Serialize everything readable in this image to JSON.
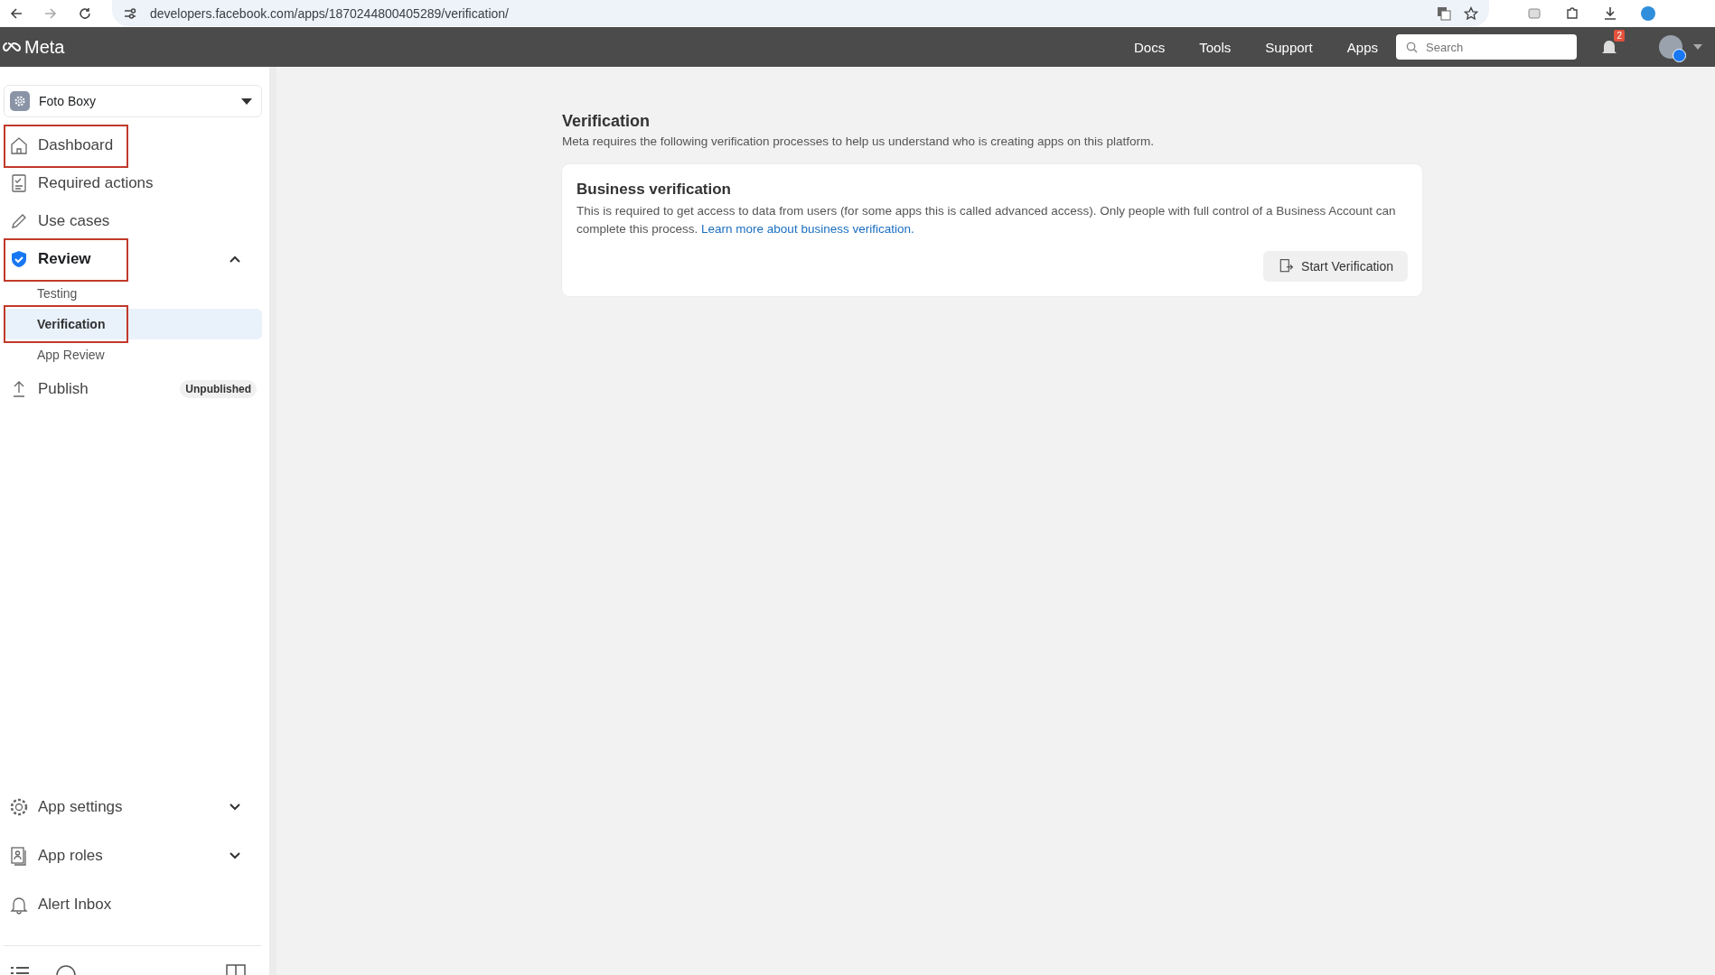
{
  "browser": {
    "url": "developers.facebook.com/apps/1870244800405289/verification/"
  },
  "header": {
    "logo": "Meta",
    "nav": [
      "Docs",
      "Tools",
      "Support",
      "Apps"
    ],
    "search": {
      "placeholder": "Search"
    },
    "notification_count": "2"
  },
  "sidebar": {
    "app_selector": "Foto Boxy",
    "items": [
      {
        "label": "Dashboard",
        "annotated": true
      },
      {
        "label": "Required actions",
        "annotated": false
      },
      {
        "label": "Use cases",
        "annotated": false
      },
      {
        "label": "Review",
        "annotated": true,
        "active": true,
        "expanded": true,
        "children": [
          {
            "label": "Testing",
            "selected": false,
            "annotated": false
          },
          {
            "label": "Verification",
            "selected": true,
            "annotated": true
          },
          {
            "label": "App Review",
            "selected": false,
            "annotated": false
          }
        ]
      },
      {
        "label": "Publish",
        "annotated": false,
        "badge": "Unpublished"
      }
    ],
    "bottom_items": [
      {
        "label": "App settings",
        "expanded": false
      },
      {
        "label": "App roles",
        "expanded": false
      },
      {
        "label": "Alert Inbox"
      }
    ]
  },
  "page": {
    "title": "Verification",
    "description": "Meta requires the following verification processes to help us understand who is creating apps on this platform.",
    "card": {
      "title": "Business verification",
      "text": "This is required to get access to data from users (for some apps this is called advanced access). Only people with full control of a Business Account can complete this process.",
      "link": "Learn more about business verification.",
      "button": "Start Verification"
    }
  }
}
